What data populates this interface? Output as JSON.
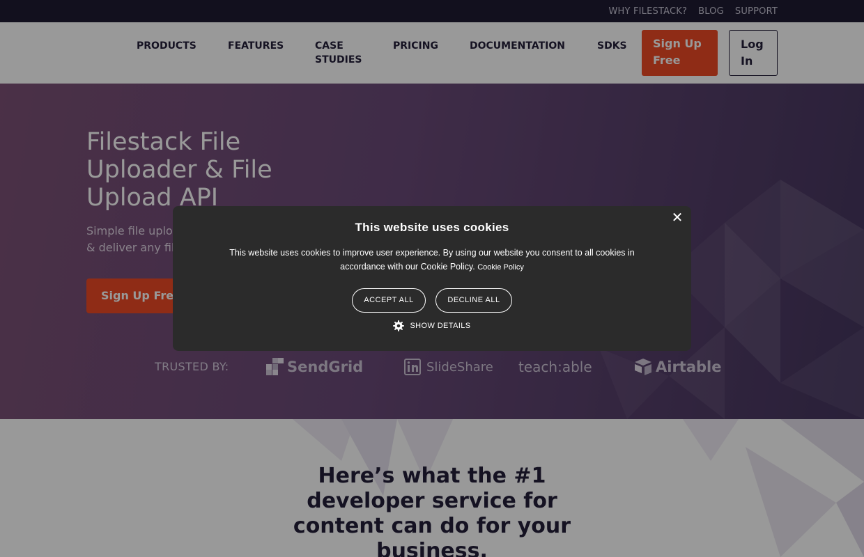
{
  "topbar": {
    "links": [
      "WHY FILESTACK?",
      "BLOG",
      "SUPPORT"
    ]
  },
  "nav": {
    "products": "PRODUCTS",
    "features": "FEATURES",
    "case_studies_line1": "CASE",
    "case_studies_line2": "STUDIES",
    "pricing": "PRICING",
    "documentation": "DOCUMENTATION",
    "sdks": "SDKS",
    "signup_line1": "Sign Up",
    "signup_line2": "Free",
    "login_line1": "Log",
    "login_line2": "In"
  },
  "hero": {
    "title": "Filestack File Uploader & File Upload API",
    "subtitle": "Simple file uplo... & deliver any fil...",
    "subtitle_line1": "Simple file uplo",
    "subtitle_line2": "& deliver any fil",
    "cta": "Sign Up Free",
    "trusted_label": "TRUSTED BY:",
    "logos": [
      "SendGrid",
      "SlideShare",
      "teach:able",
      "Airtable"
    ]
  },
  "lower": {
    "heading": "Here’s what the #1 developer service for content can do for your business."
  },
  "cookie": {
    "title": "This website uses cookies",
    "body": "This website uses cookies to improve user experience. By using our website you consent to all cookies in accordance with our Cookie Policy.",
    "policy_link": "Cookie Policy",
    "accept": "ACCEPT ALL",
    "decline": "DECLINE ALL",
    "details": "SHOW DETAILS",
    "close_glyph": "✕"
  },
  "colors": {
    "accent": "#ef4a25",
    "dark": "#231f3a",
    "topbar": "#1e1b33",
    "modal": "#2b2b2b"
  }
}
